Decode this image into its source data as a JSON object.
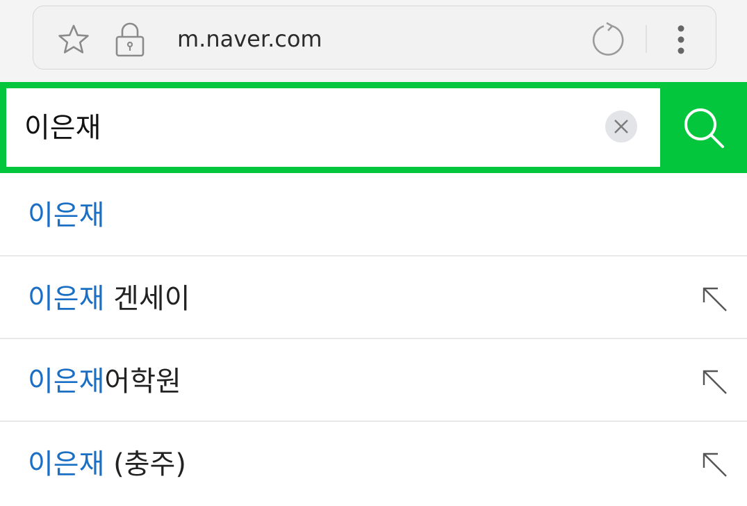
{
  "browser": {
    "url": "m.naver.com"
  },
  "search": {
    "query": "이은재",
    "accent_color": "#03c63c"
  },
  "suggestions": [
    {
      "highlight": "이은재",
      "rest": "",
      "has_arrow": false
    },
    {
      "highlight": "이은재",
      "rest": " 겐세이",
      "has_arrow": true
    },
    {
      "highlight": "이은재",
      "rest": "어학원",
      "has_arrow": true
    },
    {
      "highlight": "이은재",
      "rest": " (충주)",
      "has_arrow": true
    }
  ],
  "colors": {
    "highlight": "#1a6fc4"
  },
  "icons": {
    "bookmark": "star-icon",
    "secure": "lock-icon",
    "reload": "reload-icon",
    "menu": "more-vert-icon",
    "clear": "clear-icon",
    "search": "search-icon",
    "fill": "arrow-up-left-icon"
  }
}
